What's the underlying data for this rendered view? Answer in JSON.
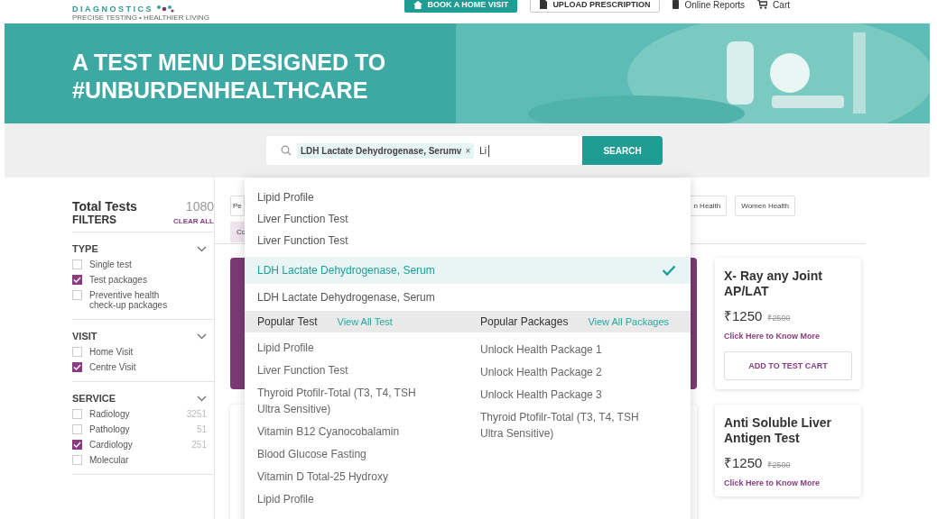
{
  "header": {
    "logo_text": "DIAGNOSTICS",
    "tagline": "PRECISE TESTING • HEALTHIER LIVING",
    "nav": [
      {
        "kind": "primary",
        "label": "BOOK A HOME VISIT"
      },
      {
        "kind": "outline",
        "label": "UPLOAD PRESCRIPTION"
      },
      {
        "kind": "reports",
        "label": "Online Reports"
      },
      {
        "kind": "cart",
        "label": "Cart"
      }
    ]
  },
  "banner": {
    "title_lines": [
      "A TEST MENU DESIGNED TO",
      "#UNBURDENHEALTHCARE"
    ]
  },
  "search": {
    "chip": "LDH Lactate Dehydrogenase, Serumv",
    "chip_close": "×",
    "value": "Li",
    "button": "SEARCH"
  },
  "sidebar": {
    "title": "Total Tests",
    "count": "1080",
    "filters_label": "FILTERS",
    "clear_all": "CLEAR ALL",
    "sections": [
      {
        "title": "TYPE",
        "expanded": true,
        "options": [
          {
            "label": "Single test",
            "checked": false
          },
          {
            "label": "Test packages",
            "checked": true
          },
          {
            "label": "Preventive health check-up packages",
            "checked": false
          }
        ]
      },
      {
        "title": "VISIT",
        "expanded": true,
        "options": [
          {
            "label": "Home Visit",
            "checked": false
          },
          {
            "label": "Centre Visit",
            "checked": true
          }
        ]
      },
      {
        "title": "SERVICE",
        "expanded": true,
        "options": [
          {
            "label": "Radiology",
            "count": "3251",
            "checked": false
          },
          {
            "label": "Pathology",
            "count": "51",
            "checked": false
          },
          {
            "label": "Cardiology",
            "count": "251",
            "checked": true
          },
          {
            "label": "Molecular",
            "checked": false
          }
        ]
      }
    ]
  },
  "chips": {
    "left": [
      "Pe"
    ],
    "right": [
      "n Health",
      "Women Health"
    ],
    "second_row": [
      "Co"
    ]
  },
  "cards": [
    {
      "title": "X- Ray any Joint AP/LAT",
      "currency": "₹",
      "price": "1250",
      "old_price": "₹2500",
      "link": "Click Here to Know More",
      "button": "ADD TO TEST CART"
    },
    {
      "title": "Anti Soluble Liver Antigen Test",
      "currency": "₹",
      "price": "1250",
      "old_price": "₹2500",
      "link": "Click Here to Know More"
    }
  ],
  "dropdown": {
    "suggestions": [
      {
        "label": "Lipid Profile",
        "selected": false
      },
      {
        "label": "Liver Function Test",
        "selected": false
      },
      {
        "label": "Liver Function Test",
        "selected": false
      },
      {
        "label": "LDH Lactate Dehydrogenase, Serum",
        "selected": true
      },
      {
        "label": "LDH Lactate Dehydrogenase, Serum",
        "selected": false
      }
    ],
    "popular_tests": {
      "title": "Popular Test",
      "link": "View All Test",
      "items": [
        "Lipid Profile",
        "Liver Function Test",
        "Thyroid Ptofilr-Total (T3, T4, TSH Ultra Sensitive)",
        "Vitamin B12 Cyanocobalamin",
        "Blood Glucose Fasting",
        "Vitamin D Total-25 Hydroxy",
        "Lipid Profile"
      ]
    },
    "popular_packages": {
      "title": "Popular Packages",
      "link": "View All Packages",
      "items": [
        "Unlock Health Package 1",
        "Unlock Health Package 2",
        "Unlock Health Package 3",
        "Thyroid Ptofilr-Total (T3, T4, TSH Ultra Sensitive)"
      ]
    }
  }
}
